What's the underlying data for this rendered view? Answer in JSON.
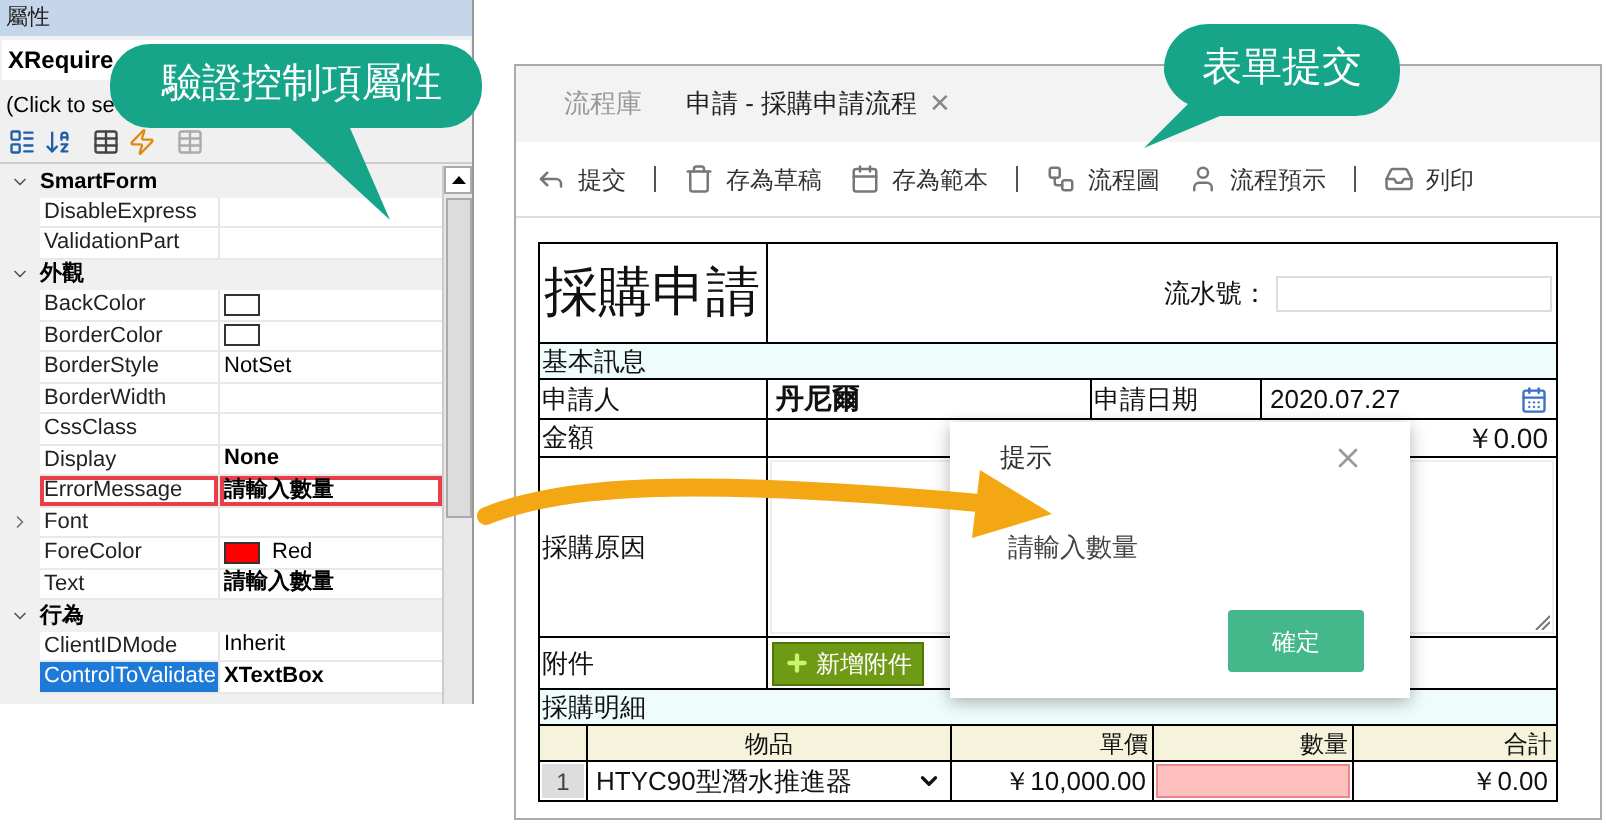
{
  "properties_panel": {
    "title": "屬性",
    "object_name": "XRequire",
    "hint": "(Click to se",
    "groups": [
      {
        "name": "SmartForm",
        "expanded": true,
        "rows": [
          {
            "name": "DisableExpress",
            "kind": "text",
            "selected": false,
            "highlighted": false
          },
          {
            "name": "ValidationPart",
            "kind": "text",
            "selected": false,
            "highlighted": false
          }
        ]
      },
      {
        "name": "外觀",
        "expanded": true,
        "rows": [
          {
            "name": "BackColor",
            "kind": "color",
            "color": "#ffffff",
            "selected": false,
            "highlighted": false
          },
          {
            "name": "BorderColor",
            "kind": "color",
            "color": "#ffffff",
            "selected": false,
            "highlighted": false
          },
          {
            "name": "BorderStyle",
            "kind": "text",
            "value": "NotSet",
            "selected": false,
            "highlighted": false
          },
          {
            "name": "BorderWidth",
            "kind": "text",
            "selected": false,
            "highlighted": false
          },
          {
            "name": "CssClass",
            "kind": "text",
            "selected": false,
            "highlighted": false
          },
          {
            "name": "Display",
            "kind": "bold",
            "value": "None",
            "selected": false,
            "highlighted": false
          },
          {
            "name": "ErrorMessage",
            "kind": "bold",
            "value": "請輸入數量",
            "selected": false,
            "highlighted": true
          },
          {
            "name": "Font",
            "kind": "expandable",
            "selected": false,
            "highlighted": false
          },
          {
            "name": "ForeColor",
            "kind": "color",
            "color": "#ff0000",
            "value": "Red",
            "selected": false,
            "highlighted": false
          },
          {
            "name": "Text",
            "kind": "bold",
            "value": "請輸入數量",
            "selected": false,
            "highlighted": false
          }
        ]
      },
      {
        "name": "行為",
        "expanded": true,
        "rows": [
          {
            "name": "ClientIDMode",
            "kind": "text",
            "value": "Inherit",
            "selected": false,
            "highlighted": false
          },
          {
            "name": "ControlToValidate",
            "kind": "bold",
            "value": "XTextBox",
            "selected": true,
            "highlighted": false
          }
        ]
      }
    ]
  },
  "callouts": [
    {
      "text": "驗證控制項屬性"
    },
    {
      "text": "表單提交"
    }
  ],
  "window": {
    "tabs": [
      {
        "label": "流程庫",
        "selected": false,
        "closable": false
      },
      {
        "label": "申請 - 採購申請流程",
        "selected": true,
        "closable": true
      }
    ],
    "close_glyph": "✕",
    "toolbar": [
      {
        "kind": "button",
        "label": "提交"
      },
      {
        "kind": "separator"
      },
      {
        "kind": "button",
        "label": "存為草稿"
      },
      {
        "kind": "button",
        "label": "存為範本"
      },
      {
        "kind": "separator"
      },
      {
        "kind": "button",
        "label": "流程圖"
      },
      {
        "kind": "button",
        "label": "流程預示"
      },
      {
        "kind": "separator"
      },
      {
        "kind": "button",
        "label": "列印"
      }
    ]
  },
  "form": {
    "title": "採購申請",
    "serial_label": "流水號：",
    "basic_section": "基本訊息",
    "applicant_label": "申請人",
    "applicant": "丹尼爾",
    "date_label": "申請日期",
    "date": "2020.07.27",
    "amount_label": "金額",
    "amount": "￥0.00",
    "reason_label": "採購原因",
    "attachment_label": "附件",
    "attach_button": "新增附件",
    "detail_section": "採購明細",
    "columns": [
      "物品",
      "單價",
      "數量",
      "合計"
    ],
    "rows": [
      {
        "index": "1",
        "item": "HTYC90型潛水推進器",
        "price": "￥10,000.00",
        "invalid": true,
        "total": "￥0.00"
      }
    ]
  },
  "dialog": {
    "title": "提示",
    "message": "請輸入數量",
    "button": "確定"
  }
}
